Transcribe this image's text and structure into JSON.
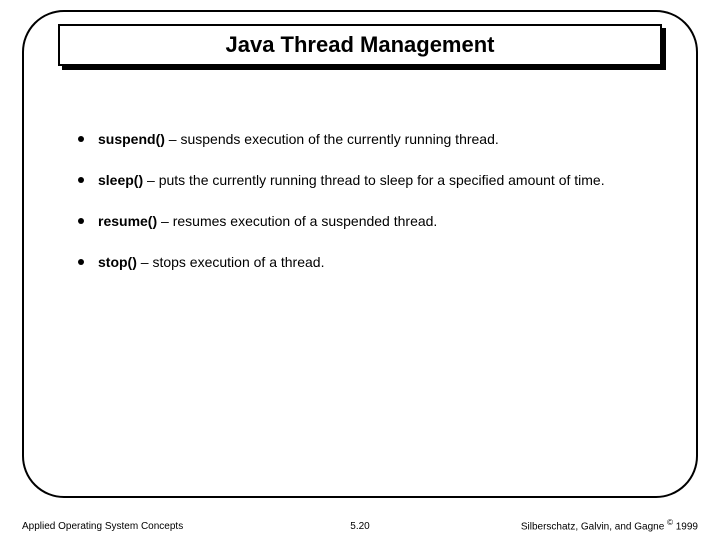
{
  "title": "Java Thread Management",
  "bullets": [
    {
      "method": "suspend()",
      "desc": " – suspends execution of the currently running thread."
    },
    {
      "method": "sleep()",
      "desc": " – puts the currently running thread to sleep for a specified amount of time."
    },
    {
      "method": "resume()",
      "desc": " – resumes execution of a suspended thread."
    },
    {
      "method": "stop()",
      "desc": " – stops execution of a thread."
    }
  ],
  "footer": {
    "left": "Applied Operating System Concepts",
    "center": "5.20",
    "right_prefix": "Silberschatz, Galvin, and Gagne ",
    "right_mark": "©",
    "right_suffix": " 1999"
  }
}
